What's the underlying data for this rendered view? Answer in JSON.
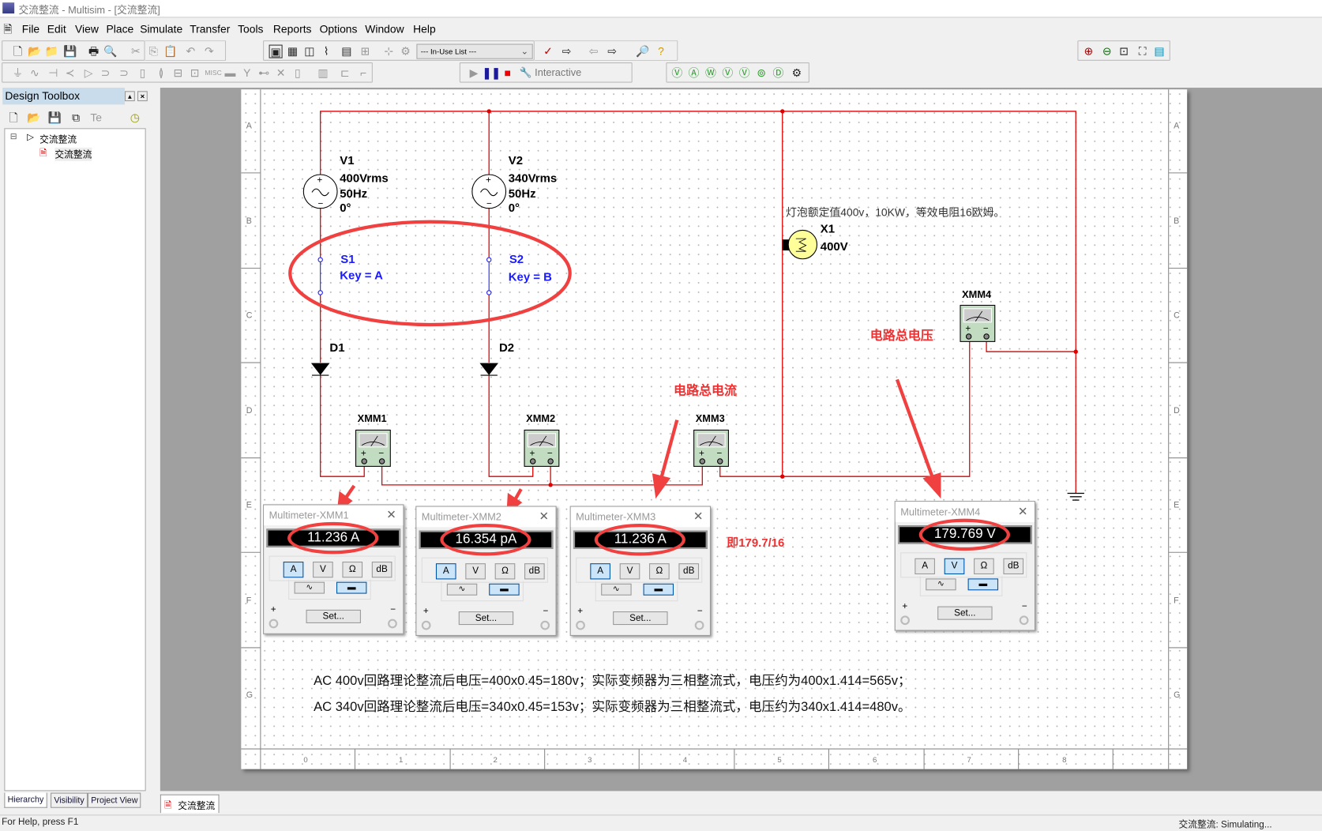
{
  "window": {
    "title": "交流整流 - Multisim - [交流整流]"
  },
  "menu": [
    "File",
    "Edit",
    "View",
    "Place",
    "Simulate",
    "Transfer",
    "Tools",
    "Reports",
    "Options",
    "Window",
    "Help"
  ],
  "toolbar": {
    "in_use_list": "--- In-Use List ---",
    "interactive": "Interactive"
  },
  "design_toolbox": {
    "title": "Design Toolbox",
    "tree": [
      {
        "label": "交流整流"
      },
      {
        "label": "交流整流"
      }
    ],
    "tabs": [
      "Hierarchy",
      "Visibility",
      "Project View"
    ]
  },
  "sheet": {
    "tab_label": "交流整流",
    "row_labels": [
      "A",
      "B",
      "C",
      "D",
      "E",
      "F",
      "G"
    ],
    "col_labels": [
      "0",
      "1",
      "2",
      "3",
      "4",
      "5",
      "6",
      "7",
      "8"
    ]
  },
  "components": {
    "V1": {
      "name": "V1",
      "voltage": "400Vrms",
      "freq": "50Hz",
      "phase": "0°"
    },
    "V2": {
      "name": "V2",
      "voltage": "340Vrms",
      "freq": "50Hz",
      "phase": "0°"
    },
    "S1": {
      "name": "S1",
      "key": "Key = A"
    },
    "S2": {
      "name": "S2",
      "key": "Key = B"
    },
    "D1": "D1",
    "D2": "D2",
    "X1": {
      "name": "X1",
      "rating": "400V"
    },
    "XMM1": "XMM1",
    "XMM2": "XMM2",
    "XMM3": "XMM3",
    "XMM4": "XMM4"
  },
  "annotations": {
    "lamp_note": "灯泡额定值400v，10KW，等效电阻16欧姆。",
    "total_voltage": "电路总电压",
    "total_current": "电路总电流",
    "calc": "即179.7/16",
    "line1": "AC 400v回路理论整流后电压=400x0.45=180v；实际变频器为三相整流式，电压约为400x1.414=565v；",
    "line2": "AC 340v回路理论整流后电压=340x0.45=153v；实际变频器为三相整流式，电压约为340x1.414=480v。"
  },
  "multimeters": [
    {
      "title": "Multimeter-XMM1",
      "reading": "11.236 A",
      "mode": "A",
      "coupling": "DC"
    },
    {
      "title": "Multimeter-XMM2",
      "reading": "16.354 pA",
      "mode": "A",
      "coupling": "DC"
    },
    {
      "title": "Multimeter-XMM3",
      "reading": "11.236 A",
      "mode": "A",
      "coupling": "DC"
    },
    {
      "title": "Multimeter-XMM4",
      "reading": "179.769 V",
      "mode": "V",
      "coupling": "DC"
    }
  ],
  "multimeter_ui": {
    "modes": [
      "A",
      "V",
      "Ω",
      "dB"
    ],
    "set_label": "Set...",
    "plus": "+",
    "minus": "−"
  },
  "status": {
    "help": "For Help, press F1",
    "sim": "交流整流: Simulating..."
  },
  "colors": {
    "wire": "#e00000",
    "annotation": "#f03030",
    "switch": "#1a1aff",
    "meter_body": "#c2dcc2"
  }
}
